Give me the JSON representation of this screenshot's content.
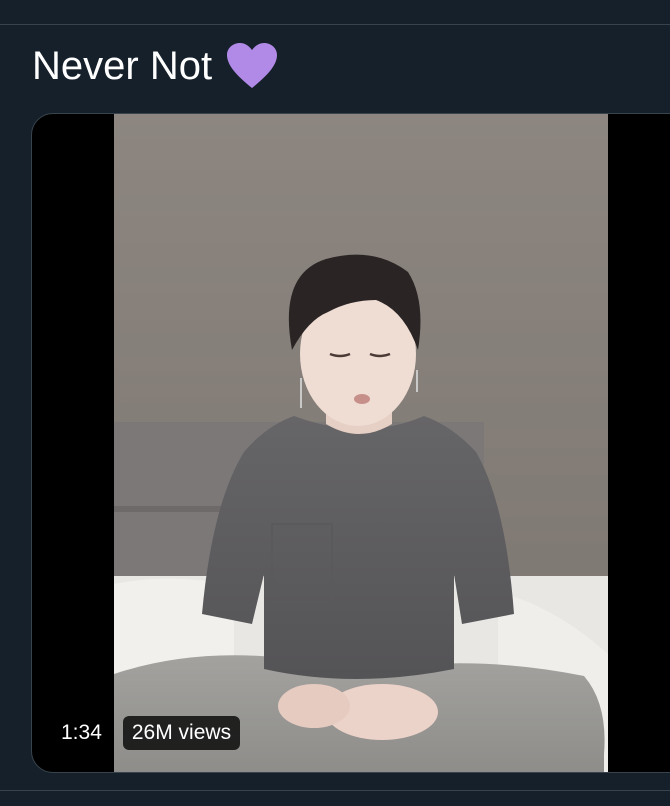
{
  "tweet": {
    "text": "Never Not",
    "emoji_icon": "purple-heart-icon"
  },
  "video": {
    "duration": "1:34",
    "views": "26M views"
  },
  "colors": {
    "background": "#15202b",
    "divider": "#38444d",
    "heart": "#b18ae8",
    "text": "#ffffff"
  }
}
